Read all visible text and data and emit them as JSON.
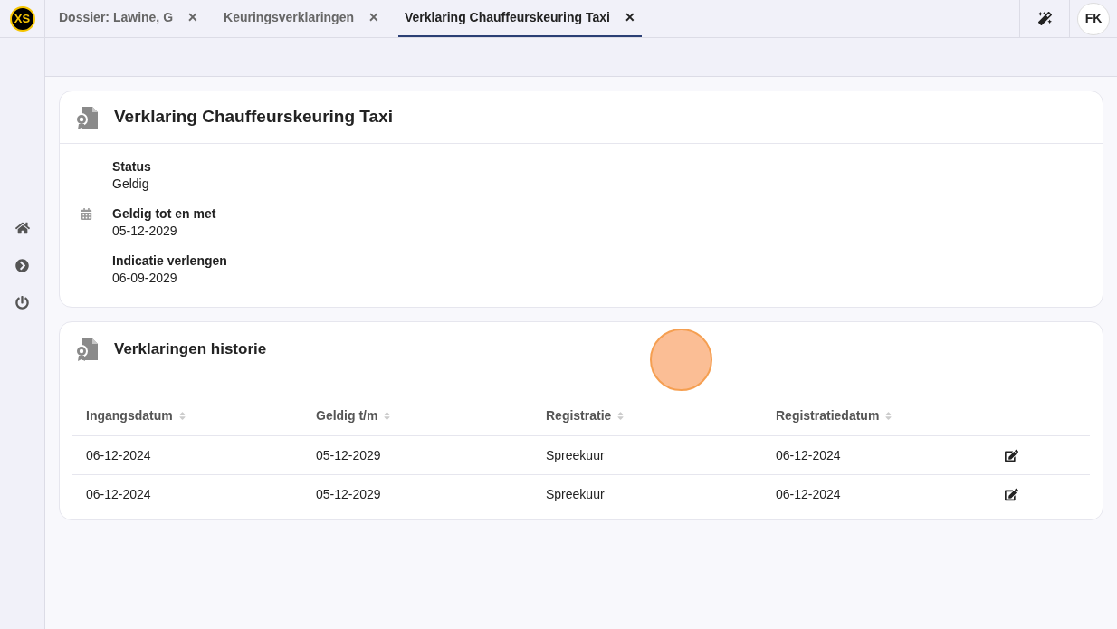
{
  "logo": "XS",
  "tabs": [
    {
      "label": "Dossier: Lawine, G",
      "selected": false,
      "close": "✕"
    },
    {
      "label": "Keuringsverklaringen",
      "selected": false,
      "close": "✕"
    },
    {
      "label": "Verklaring Chauffeurskeuring Taxi",
      "selected": true,
      "close": "✕"
    }
  ],
  "user": {
    "initials": "FK"
  },
  "details": {
    "title": "Verklaring Chauffeurskeuring Taxi",
    "fields": [
      {
        "label": "Status",
        "value": "Geldig",
        "kind": "text"
      },
      {
        "label": "Geldig tot en met",
        "value": "05-12-2029",
        "kind": "date"
      },
      {
        "label": "Indicatie verlengen",
        "value": "06-09-2029",
        "kind": "text"
      }
    ]
  },
  "history": {
    "title": "Verklaringen historie",
    "columns": [
      "Ingangsdatum",
      "Geldig t/m",
      "Registratie",
      "Registratiedatum"
    ],
    "rows": [
      [
        "06-12-2024",
        "05-12-2029",
        "Spreekuur",
        "06-12-2024"
      ],
      [
        "06-12-2024",
        "05-12-2029",
        "Spreekuur",
        "06-12-2024"
      ]
    ]
  }
}
